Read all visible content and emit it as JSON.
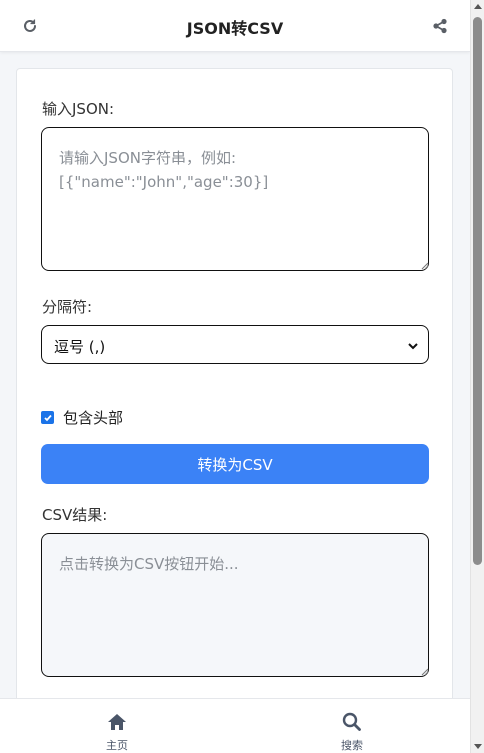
{
  "header": {
    "title": "JSON转CSV",
    "refresh_icon": "refresh-icon",
    "share_icon": "share-icon"
  },
  "form": {
    "json_label": "输入JSON:",
    "json_placeholder": "请输入JSON字符串，例如:\n[{\"name\":\"John\",\"age\":30}]",
    "json_value": "",
    "separator_label": "分隔符:",
    "separator_selected": "逗号 (,)",
    "include_header_label": "包含头部",
    "include_header_checked": true,
    "convert_button": "转换为CSV",
    "csv_label": "CSV结果:",
    "csv_placeholder": "点击转换为CSV按钮开始..."
  },
  "bottom_nav": {
    "items": [
      {
        "label": "主页",
        "icon": "home-icon"
      },
      {
        "label": "搜索",
        "icon": "search-icon"
      }
    ]
  },
  "colors": {
    "accent": "#3b82f6",
    "checkbox": "#1a73e8",
    "nav_icon": "#4a5568"
  }
}
